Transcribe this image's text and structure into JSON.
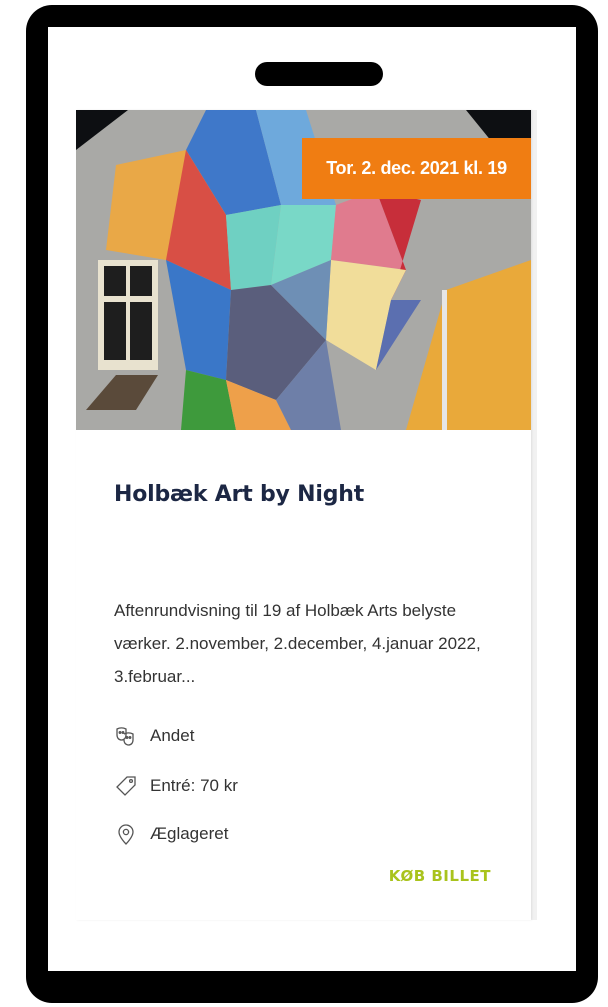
{
  "event": {
    "date_badge": "Tor. 2. dec. 2021 kl. 19",
    "title": "Holbæk Art by Night",
    "description": "Aftenrundvisning til 19 af Holbæk Arts belyste værker. 2.november, 2.december, 4.januar 2022, 3.februar...",
    "meta": {
      "category": {
        "icon": "theater-masks-icon",
        "text": "Andet"
      },
      "price": {
        "icon": "price-tag-icon",
        "text": "Entré: 70 kr"
      },
      "venue": {
        "icon": "location-pin-icon",
        "text": "Æglageret"
      }
    },
    "buy_label": "KØB BILLET",
    "image": {
      "alt": "Holbæk Art by Night mural"
    }
  },
  "colors": {
    "badge": "#f07d12",
    "title": "#1c2744",
    "buy_button": "#a9c31c",
    "phone_frame": "#000000"
  }
}
